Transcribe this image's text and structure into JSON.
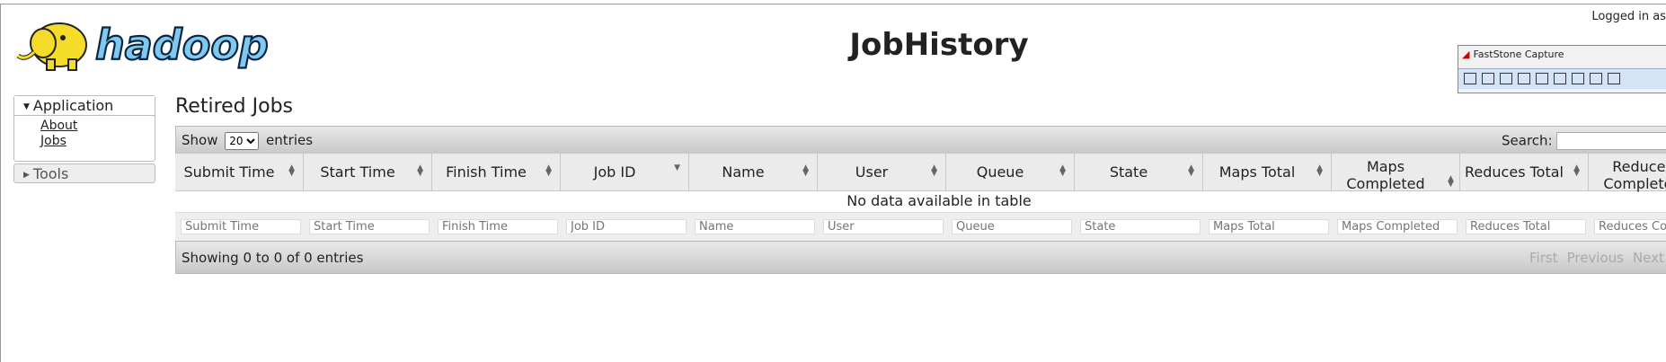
{
  "header": {
    "title": "JobHistory",
    "logged_in": "Logged in as",
    "logo_alt": "hadoop"
  },
  "sidebar": {
    "application": {
      "label": "Application",
      "links": [
        {
          "label": "About"
        },
        {
          "label": "Jobs"
        }
      ]
    },
    "tools": {
      "label": "Tools"
    }
  },
  "main": {
    "heading": "Retired Jobs",
    "show_prefix": "Show",
    "show_value": "20",
    "show_suffix": "entries",
    "search_label": "Search:",
    "columns": [
      {
        "label": "Submit Time"
      },
      {
        "label": "Start Time"
      },
      {
        "label": "Finish Time"
      },
      {
        "label": "Job ID"
      },
      {
        "label": "Name"
      },
      {
        "label": "User"
      },
      {
        "label": "Queue"
      },
      {
        "label": "State"
      },
      {
        "label": "Maps Total"
      },
      {
        "label": "Maps Completed"
      },
      {
        "label": "Reduces Total"
      },
      {
        "label": "Reduces Completed"
      }
    ],
    "no_data": "No data available in table",
    "filters": [
      "Submit Time",
      "Start Time",
      "Finish Time",
      "Job ID",
      "Name",
      "User",
      "Queue",
      "State",
      "Maps Total",
      "Maps Completed",
      "Reduces Total",
      "Reduces Completed"
    ],
    "info": "Showing 0 to 0 of 0 entries",
    "pager": {
      "first": "First",
      "previous": "Previous",
      "next": "Next"
    }
  },
  "overlay": {
    "title": "FastStone Capture"
  }
}
